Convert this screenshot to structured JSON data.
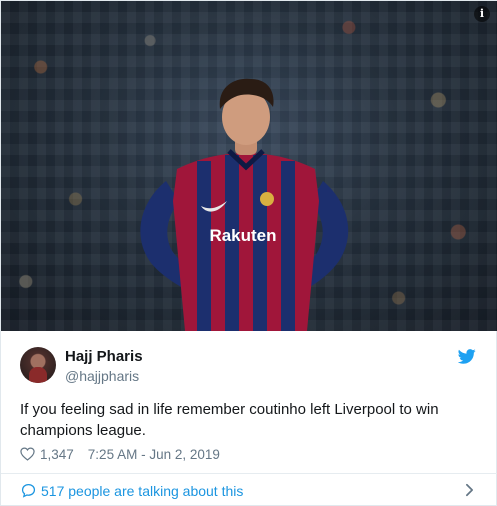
{
  "photo": {
    "info_badge": "i",
    "jersey_sponsor": "Rakuten"
  },
  "tweet": {
    "display_name": "Hajj Pharis",
    "handle": "@hajjpharis",
    "text": "If you feeling sad in life remember coutinho left Liverpool to win champions league.",
    "likes": "1,347",
    "timestamp": "7:25 AM - Jun 2, 2019",
    "talking": "517 people are talking about this",
    "icons": {
      "platform": "twitter-bird-icon",
      "like": "heart-icon",
      "reply": "speech-bubble-icon",
      "more": "chevron-right-icon",
      "info": "info-icon"
    },
    "colors": {
      "accent": "#1da1f2",
      "link": "#1b95e0",
      "muted": "#657786",
      "text": "#14171a"
    }
  }
}
